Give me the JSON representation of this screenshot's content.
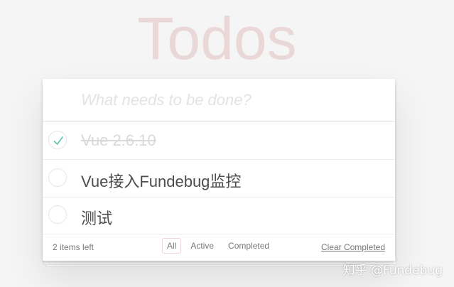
{
  "app": {
    "title": "Todos"
  },
  "new_todo": {
    "placeholder": "What needs to be done?",
    "value": ""
  },
  "todos": [
    {
      "label": "Vue 2.6.10",
      "completed": true
    },
    {
      "label": "Vue接入Fundebug监控",
      "completed": false
    },
    {
      "label": "测试",
      "completed": false
    }
  ],
  "footer": {
    "count_text": "2 items left",
    "filters": [
      {
        "label": "All",
        "selected": true
      },
      {
        "label": "Active",
        "selected": false
      },
      {
        "label": "Completed",
        "selected": false
      }
    ],
    "clear_label": "Clear Completed"
  },
  "watermark": {
    "text": "知乎 @Fundebug"
  },
  "colors": {
    "check": "#5dc2af",
    "title": "#ead7d7"
  }
}
